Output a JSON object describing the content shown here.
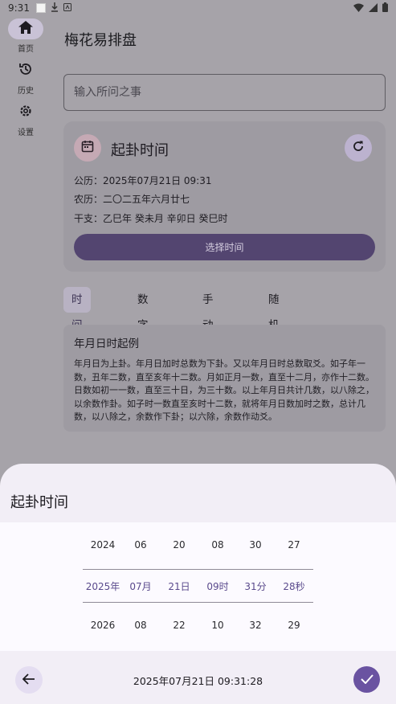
{
  "status_bar": {
    "time": "9:31"
  },
  "nav": {
    "items": [
      {
        "label": "首页",
        "icon": "home-icon",
        "active": true
      },
      {
        "label": "历史",
        "icon": "history-icon",
        "active": false
      },
      {
        "label": "设置",
        "icon": "gear-icon",
        "active": false
      }
    ]
  },
  "app": {
    "title": "梅花易排盘"
  },
  "question": {
    "placeholder": "输入所问之事",
    "value": ""
  },
  "time_card": {
    "title": "起卦时间",
    "gregorian": "公历：2025年07月21日 09:31",
    "lunar": "农历：二〇二五年六月廿七",
    "ganzhi": "干支：乙巳年 癸未月 辛卯日 癸巳时",
    "select_button": "选择时间"
  },
  "tabs": [
    {
      "label": "时间起卦",
      "active": true
    },
    {
      "label": "数字起卦",
      "active": false
    },
    {
      "label": "手动指定",
      "active": false
    },
    {
      "label": "随机起卦",
      "active": false
    }
  ],
  "example": {
    "title": "年月日时起例",
    "text": "年月日为上卦。年月日加时总数为下卦。又以年月日时总数取爻。如子年一数，丑年二数，直至亥年十二数。月如正月一数，直至十二月，亦作十二数。日数如初一一数，直至三十日，为三十数。以上年月日共计几数，以八除之，以余数作卦。如子时一数直至亥时十二数，就将年月日数加时之数，总计几数，以八除之，余数作下卦；以六除，余数作动爻。"
  },
  "sheet": {
    "title": "起卦时间",
    "columns": [
      {
        "name": "year",
        "prev": "2024",
        "selected": "2025年",
        "next": "2026"
      },
      {
        "name": "month",
        "prev": "06",
        "selected": "07月",
        "next": "08"
      },
      {
        "name": "day",
        "prev": "20",
        "selected": "21日",
        "next": "22"
      },
      {
        "name": "hour",
        "prev": "08",
        "selected": "09时",
        "next": "10"
      },
      {
        "name": "minute",
        "prev": "30",
        "selected": "31分",
        "next": "32"
      },
      {
        "name": "second",
        "prev": "27",
        "selected": "28秒",
        "next": "29"
      }
    ],
    "datetime_display": "2025年07月21日 09:31:28"
  },
  "colors": {
    "scrim": "#a6a3a9",
    "primary": "#6a53a1",
    "selected_text": "#5a4a8c",
    "sheet_background": "#f2eef6"
  }
}
